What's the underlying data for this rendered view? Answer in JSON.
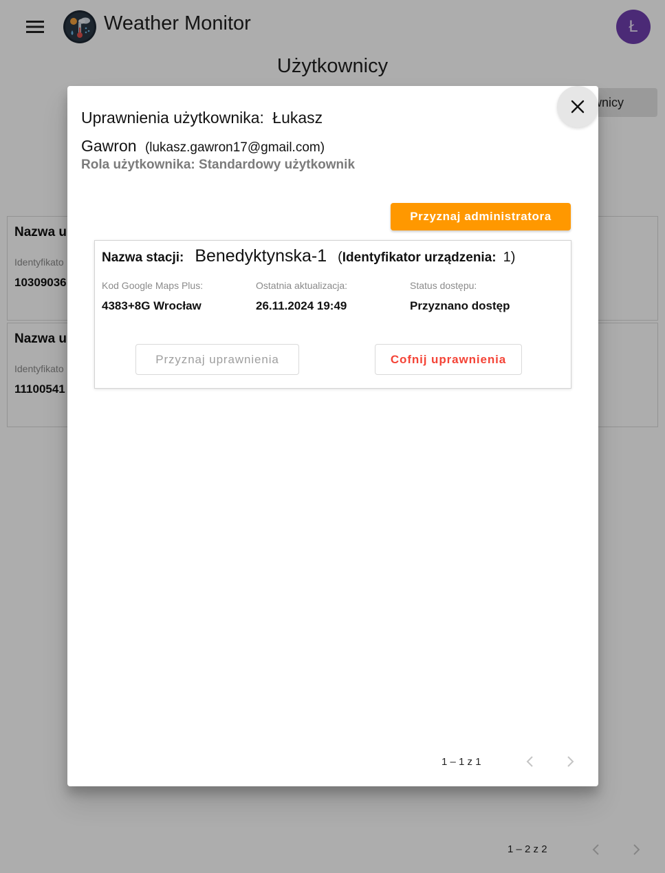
{
  "app": {
    "title": "Weather Monitor",
    "avatar_initial": "Ł"
  },
  "page": {
    "title": "Użytkownicy",
    "users_button_label": "tkownicy",
    "cards": [
      {
        "title": "Nazwa u",
        "label": "Identyfikato",
        "value": "10309036"
      },
      {
        "title": "Nazwa u",
        "label": "Identyfikato",
        "value": "11100541"
      }
    ],
    "pager_range": "1 – 2 z 2"
  },
  "dialog": {
    "title_prefix": "Uprawnienia użytkownika:",
    "user_name": "Łukasz Gawron",
    "email": "(lukasz.gawron17@gmail.com)",
    "role": "Rola użytkownika: Standardowy użytkownik",
    "admin_button": "Przyznaj administratora",
    "station": {
      "name_label": "Nazwa stacji:",
      "name": "Benedyktynska-1",
      "paren_open": "(",
      "id_label": "Identyfikator urządzenia:",
      "id": "1)",
      "fields": [
        {
          "label": "Kod Google Maps Plus:",
          "value": "4383+8G Wrocław"
        },
        {
          "label": "Ostatnia aktualizacja:",
          "value": "26.11.2024 19:49"
        },
        {
          "label": "Status dostępu:",
          "value": "Przyznano dostęp"
        }
      ],
      "grant_button": "Przyznaj uprawnienia",
      "revoke_button": "Cofnij uprawnienia"
    },
    "pager_range": "1 – 1 z 1"
  },
  "colors": {
    "accent": "#ff9800",
    "avatar": "#6f3fae",
    "danger": "#f44336"
  },
  "icons": [
    "menu-icon",
    "weather-logo-icon",
    "close-icon",
    "chevron-left-icon",
    "chevron-right-icon"
  ]
}
